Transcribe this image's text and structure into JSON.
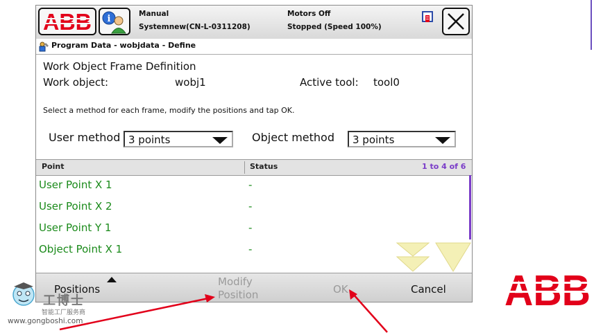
{
  "topbar": {
    "mode": "Manual",
    "system": "Systemnew(CN-L-0311208)",
    "motors": "Motors Off",
    "state": "Stopped (Speed 100%)"
  },
  "subtitle": "Program Data - wobjdata - Define",
  "form": {
    "heading": "Work Object Frame Definition",
    "wobj_label": "Work object:",
    "wobj_value": "wobj1",
    "tool_label": "Active tool:",
    "tool_value": "tool0",
    "instruction": "Select a method for each frame, modify the positions and tap OK.",
    "user_method_label": "User method",
    "user_method_value": "3 points",
    "object_method_label": "Object method",
    "object_method_value": "3 points"
  },
  "table": {
    "col_point": "Point",
    "col_status": "Status",
    "range": "1 to 4 of 6",
    "rows": [
      {
        "point": "User Point X 1",
        "status": "-"
      },
      {
        "point": "User Point X 2",
        "status": "-"
      },
      {
        "point": "User Point Y 1",
        "status": "-"
      },
      {
        "point": "Object Point X 1",
        "status": "-"
      }
    ]
  },
  "bottombar": {
    "positions": "Positions",
    "modify_line1": "Modify",
    "modify_line2": "Position",
    "ok": "OK",
    "cancel": "Cancel"
  },
  "watermark": {
    "brand": "工博士",
    "slogan": "智能工厂服务商",
    "url": "www.gongboshi.com"
  },
  "logo_text": "ABB",
  "colors": {
    "abb_red": "#e2001a",
    "point_green": "#1a8a1a",
    "range_purple": "#7a3cc8",
    "disabled_gray": "#9a9a9a",
    "arrow_red": "#e2001a"
  }
}
